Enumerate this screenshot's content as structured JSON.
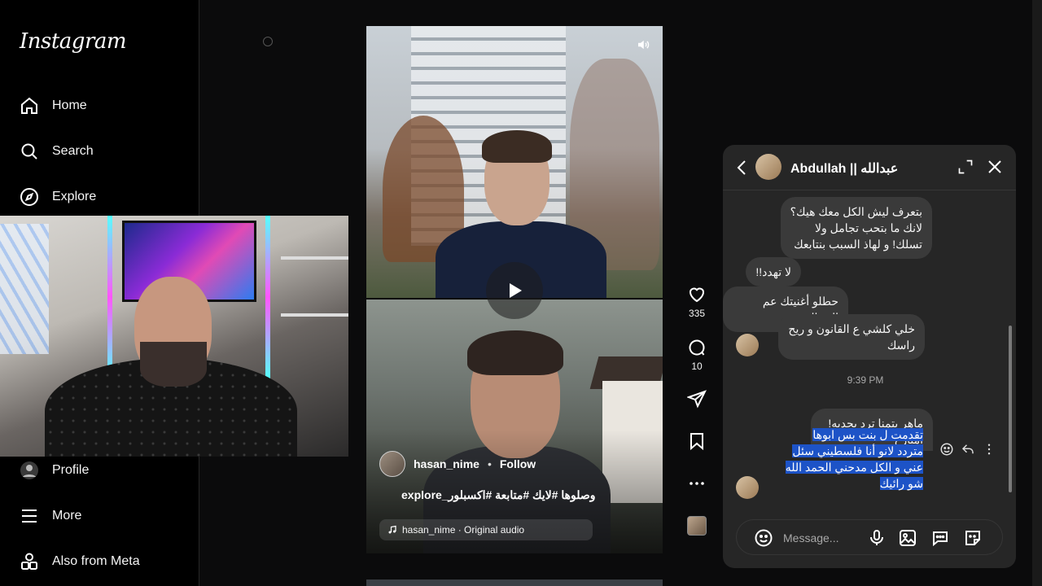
{
  "app": {
    "logo": "Instagram"
  },
  "sidebar": {
    "items": [
      {
        "label": "Home",
        "icon": "home-icon"
      },
      {
        "label": "Search",
        "icon": "search-icon"
      },
      {
        "label": "Explore",
        "icon": "compass-icon"
      },
      {
        "label": "Profile",
        "icon": "profile-avatar"
      },
      {
        "label": "More",
        "icon": "menu-icon"
      },
      {
        "label": "Also from Meta",
        "icon": "meta-grid-icon"
      }
    ]
  },
  "reel": {
    "author": "hasan_nime",
    "separator": "•",
    "follow_label": "Follow",
    "caption": "وصلوها #لايك #متابعة #اكسبلور_explore",
    "audio": "hasan_nime · Original audio",
    "likes": "335",
    "comments": "10"
  },
  "chat": {
    "title": "Abdullah || عبدالله",
    "time_divider": "9:39 PM",
    "messages": [
      "بتعرف ليش الكل معك هيك؟\nلانك ما بتحب تجامل ولا\nتسلك! و لهاذ السبب بنتابعك",
      "لا تهدد!!",
      "حطلو أغنيتك عم المجال",
      "خلي كلشي ع القانون و ريح\nراسك",
      "ماهر بتمنا ترد بجديه! امبارح"
    ],
    "selected_message": "تقدمت ل بنت بس ابوها\nمتردد لانو أنا فلسطيني سئل\nعني و الكل مدحني الحمد الله\nشو رائيك",
    "composer_placeholder": "Message..."
  },
  "colors": {
    "background": "#000000",
    "panel": "#262626",
    "bubble": "#3a3a3a",
    "selection": "#1d53c7",
    "text": "#f5f5f5",
    "muted": "#a8a8a8"
  }
}
